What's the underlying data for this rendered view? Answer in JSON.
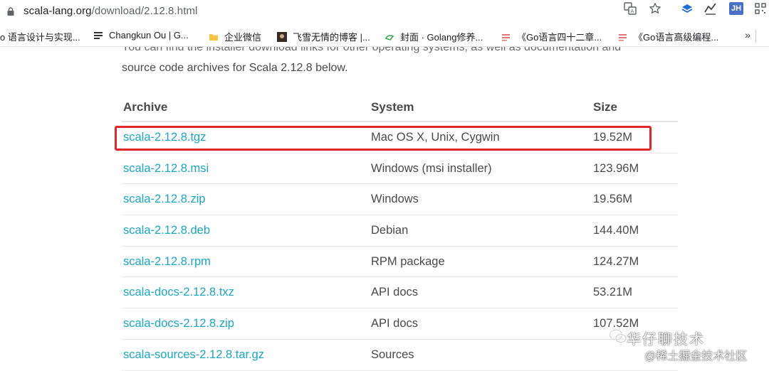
{
  "browser": {
    "url_host": "scala-lang.org",
    "url_path": "/download/2.12.8.html",
    "jh_label": "JH"
  },
  "bookmarks": {
    "items": [
      {
        "label": "o 语言设计与实现..."
      },
      {
        "label": "Changkun Ou | G..."
      },
      {
        "label": "企业微信"
      },
      {
        "label": "飞雪无情的博客 |..."
      },
      {
        "label": "封面 · Golang修养..."
      },
      {
        "label": "《Go语言四十二章..."
      },
      {
        "label": "《Go语言高级编程..."
      }
    ],
    "more": "»"
  },
  "page": {
    "intro_line1": "You can find the installer download links for other operating systems, as well as documentation and",
    "intro_line2": "source code archives for Scala 2.12.8 below.",
    "table": {
      "headers": {
        "archive": "Archive",
        "system": "System",
        "size": "Size"
      },
      "rows": [
        {
          "archive": "scala-2.12.8.tgz",
          "system": "Mac OS X, Unix, Cygwin",
          "size": "19.52M"
        },
        {
          "archive": "scala-2.12.8.msi",
          "system": "Windows (msi installer)",
          "size": "123.96M"
        },
        {
          "archive": "scala-2.12.8.zip",
          "system": "Windows",
          "size": "19.56M"
        },
        {
          "archive": "scala-2.12.8.deb",
          "system": "Debian",
          "size": "144.40M"
        },
        {
          "archive": "scala-2.12.8.rpm",
          "system": "RPM package",
          "size": "124.27M"
        },
        {
          "archive": "scala-docs-2.12.8.txz",
          "system": "API docs",
          "size": "53.21M"
        },
        {
          "archive": "scala-docs-2.12.8.zip",
          "system": "API docs",
          "size": "107.52M"
        },
        {
          "archive": "scala-sources-2.12.8.tar.gz",
          "system": "Sources",
          "size": ""
        }
      ]
    }
  },
  "watermark": {
    "line1": "华仔聊技术",
    "line2": "@稀土掘金技术社区"
  },
  "colors": {
    "link": "#1aa6c4",
    "highlight": "#e0262a"
  }
}
